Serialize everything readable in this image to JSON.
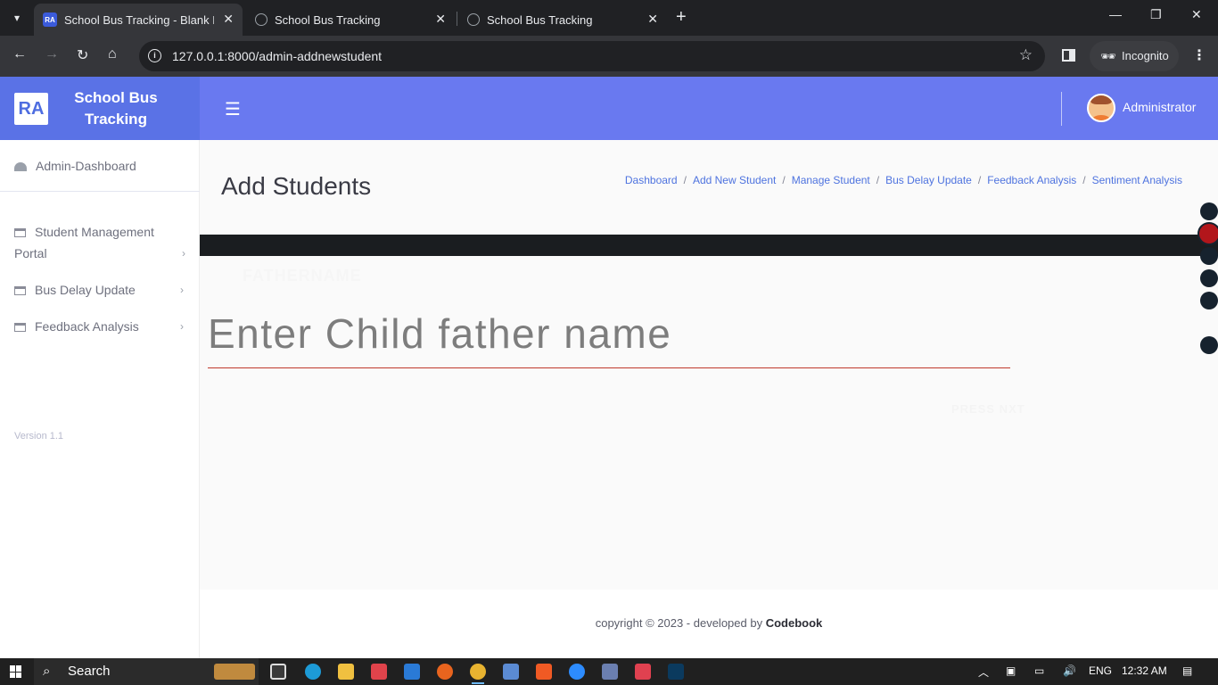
{
  "browser": {
    "tabs": [
      {
        "title": "School Bus Tracking - Blank Pa",
        "active": true,
        "favicon": "ra-logo"
      },
      {
        "title": "School Bus Tracking",
        "active": false,
        "favicon": "globe-icon"
      },
      {
        "title": "School Bus Tracking",
        "active": false,
        "favicon": "globe-icon"
      }
    ],
    "url": "127.0.0.1:8000/admin-addnewstudent",
    "incognito_label": "Incognito"
  },
  "app": {
    "logo_text": "RA",
    "brand_name": "School Bus Tracking",
    "user_name": "Administrator",
    "colors": {
      "brand": "#5a72e6",
      "topbar": "#6979f0",
      "link": "#4e73df",
      "input_underline": "#c0392b"
    }
  },
  "sidebar": {
    "dashboard": "Admin-Dashboard",
    "items": [
      {
        "label": "Student Management Portal"
      },
      {
        "label": "Bus Delay Update"
      },
      {
        "label": "Feedback Analysis"
      }
    ],
    "version": "Version 1.1"
  },
  "main": {
    "title": "Add Students",
    "breadcrumb": [
      "Dashboard",
      "Add New Student",
      "Manage Student",
      "Bus Delay Update",
      "Feedback Analysis",
      "Sentiment Analysis"
    ],
    "field_label": "FATHERNAME",
    "input_placeholder": "Enter Child father name",
    "ghost_button": "PRESS NXT"
  },
  "footer": {
    "prefix": "copyright © 2023 - developed by ",
    "brand": "Codebook"
  },
  "taskbar": {
    "search_label": "Search",
    "language": "ENG",
    "time": "12:32 AM"
  }
}
